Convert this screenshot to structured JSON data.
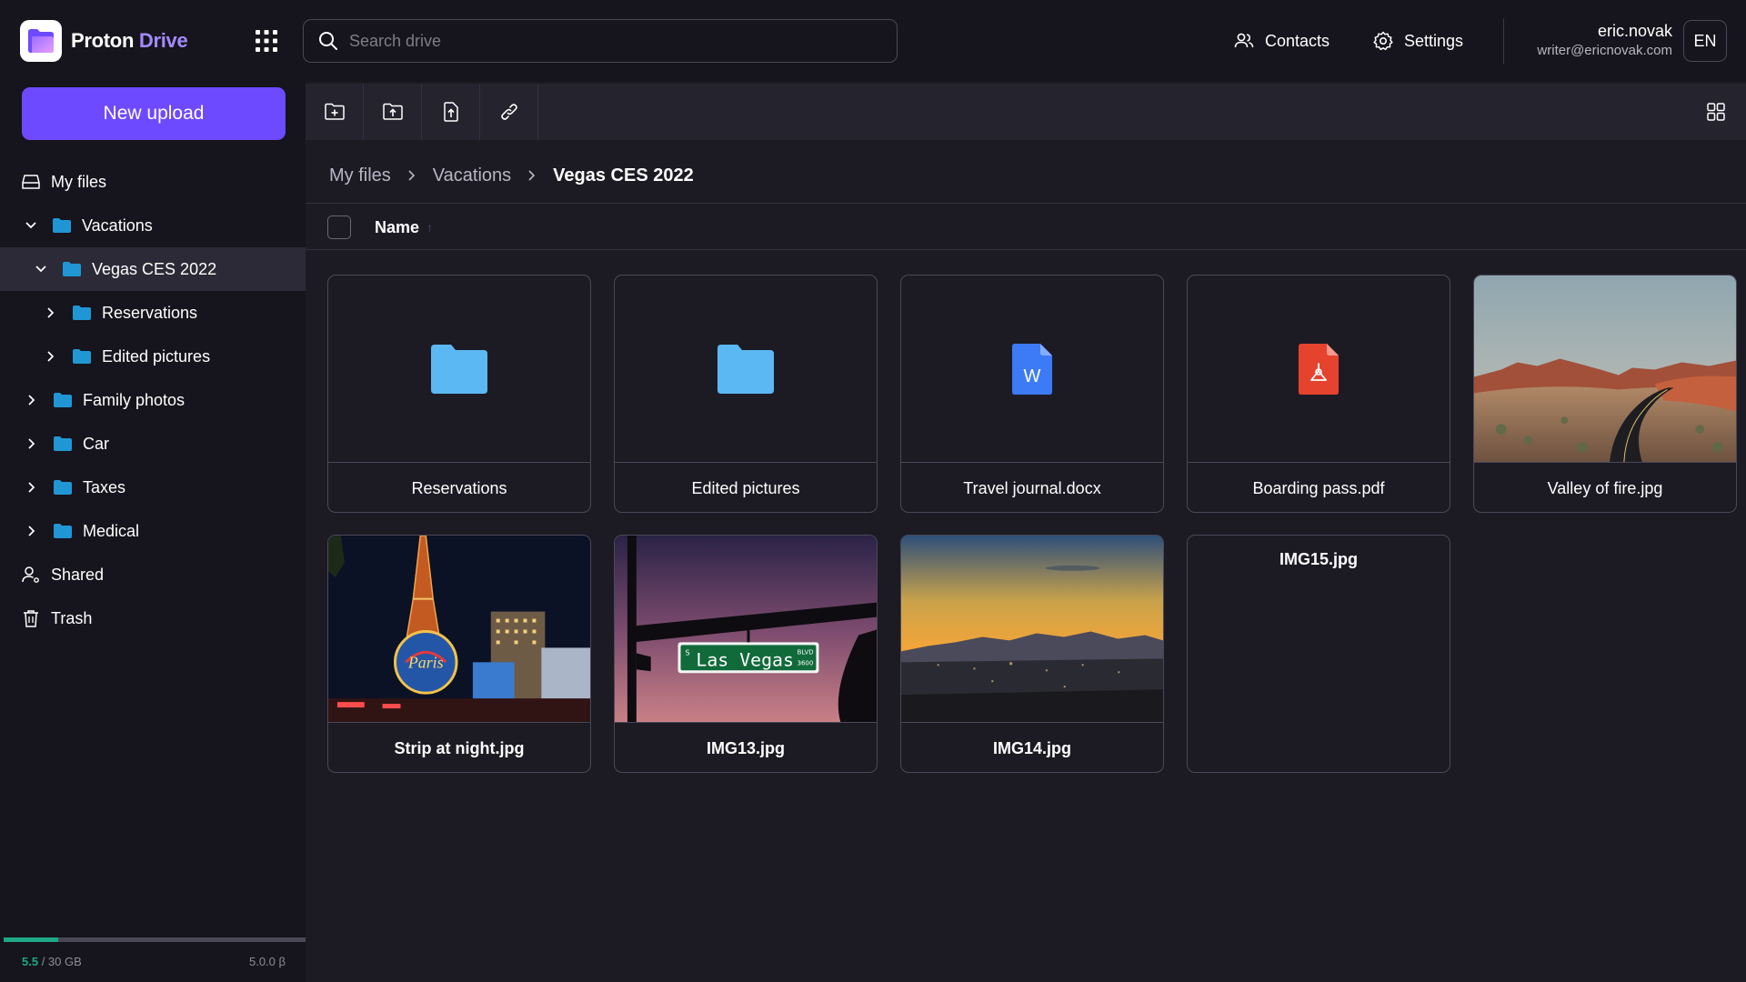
{
  "app": {
    "brand_first": "Proton",
    "brand_second": "Drive",
    "accent": "#6d4aff"
  },
  "header": {
    "search_placeholder": "Search drive",
    "contacts_label": "Contacts",
    "settings_label": "Settings",
    "user_name": "eric.novak",
    "user_email": "writer@ericnovak.com",
    "language": "EN"
  },
  "sidebar": {
    "new_upload_label": "New upload",
    "items": [
      {
        "label": "My files",
        "icon": "drive-icon"
      },
      {
        "label": "Vacations",
        "icon": "folder-icon",
        "expanded": true
      },
      {
        "label": "Vegas CES 2022",
        "icon": "folder-icon",
        "expanded": true,
        "active": true
      },
      {
        "label": "Reservations",
        "icon": "folder-icon"
      },
      {
        "label": "Edited pictures",
        "icon": "folder-icon"
      },
      {
        "label": "Family photos",
        "icon": "folder-icon"
      },
      {
        "label": "Car",
        "icon": "folder-icon"
      },
      {
        "label": "Taxes",
        "icon": "folder-icon"
      },
      {
        "label": "Medical",
        "icon": "folder-icon"
      },
      {
        "label": "Shared",
        "icon": "shared-user-icon"
      },
      {
        "label": "Trash",
        "icon": "trash-icon"
      }
    ],
    "storage_used": "5.5",
    "storage_total": "/ 30 GB",
    "storage_fraction": 0.18,
    "version": "5.0.0 β"
  },
  "toolbar": {
    "buttons": [
      "new-folder-icon",
      "upload-folder-icon",
      "upload-file-icon",
      "link-icon"
    ],
    "layout": "grid-layout-icon"
  },
  "breadcrumb": {
    "items": [
      "My files",
      "Vacations",
      "Vegas CES 2022"
    ]
  },
  "list": {
    "name_header": "Name",
    "sort": "ascending"
  },
  "files": [
    {
      "name": "Reservations",
      "type": "folder"
    },
    {
      "name": "Edited pictures",
      "type": "folder"
    },
    {
      "name": "Travel journal.docx",
      "type": "docx"
    },
    {
      "name": "Boarding pass.pdf",
      "type": "pdf"
    },
    {
      "name": "Valley of fire.jpg",
      "type": "image"
    },
    {
      "name": "Strip at night.jpg",
      "type": "image"
    },
    {
      "name": "IMG13.jpg",
      "type": "image"
    },
    {
      "name": "IMG14.jpg",
      "type": "image"
    },
    {
      "name": "IMG15.jpg",
      "type": "image"
    }
  ],
  "photo_text": {
    "street_sign": "Las Vegas",
    "sign_small_top": "BLVD",
    "sign_small_bottom": "3600",
    "sign_s": "S"
  },
  "colors": {
    "folder": "#5cb8f2",
    "sidebar_folder": "#2196d4",
    "docx": "#3d7af5",
    "pdf": "#e5432e",
    "storage": "#1ea885"
  }
}
